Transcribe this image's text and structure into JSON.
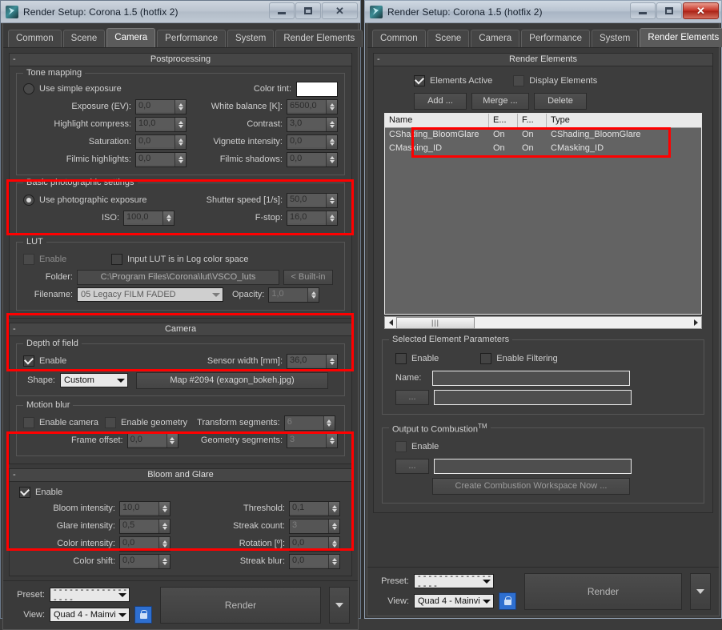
{
  "window_left": {
    "title": "Render Setup: Corona 1.5 (hotfix 2)",
    "tabs": [
      "Common",
      "Scene",
      "Camera",
      "Performance",
      "System",
      "Render Elements"
    ],
    "active_tab": "Camera",
    "rollout_postprocessing": {
      "title": "Postprocessing",
      "tone_mapping": {
        "label": "Tone mapping",
        "use_simple_exposure": "Use simple exposure",
        "use_simple_exposure_checked": false,
        "color_tint_label": "Color tint:",
        "color_tint_value": "#ffffff",
        "fields": [
          {
            "label": "Exposure (EV):",
            "value": "0,0"
          },
          {
            "label": "White balance [K]:",
            "value": "6500,0"
          },
          {
            "label": "Highlight compress:",
            "value": "10,0"
          },
          {
            "label": "Contrast:",
            "value": "3,0"
          },
          {
            "label": "Saturation:",
            "value": "0,0"
          },
          {
            "label": "Vignette intensity:",
            "value": "0,0"
          },
          {
            "label": "Filmic highlights:",
            "value": "0,0"
          },
          {
            "label": "Filmic shadows:",
            "value": "0,0"
          }
        ]
      },
      "basic_photographic": {
        "label": "Basic photographic settings",
        "use_photographic_exposure": "Use photographic exposure",
        "use_photographic_exposure_checked": true,
        "shutter_label": "Shutter speed [1/s]:",
        "shutter_value": "50,0",
        "iso_label": "ISO:",
        "iso_value": "100,0",
        "fstop_label": "F-stop:",
        "fstop_value": "16,0"
      },
      "lut": {
        "label": "LUT",
        "enable_label": "Enable",
        "enable_checked": false,
        "log_label": "Input LUT is in Log color space",
        "log_checked": false,
        "folder_label": "Folder:",
        "folder_value": "C:\\Program Files\\Corona\\lut\\VSCO_luts",
        "builtin_button": "< Built-in",
        "filename_label": "Filename:",
        "filename_value": "05 Legacy FILM FADED",
        "opacity_label": "Opacity:",
        "opacity_value": "1,0"
      }
    },
    "rollout_camera": {
      "title": "Camera",
      "depth_of_field": {
        "label": "Depth of field",
        "enable_label": "Enable",
        "enable_checked": true,
        "sensor_label": "Sensor width [mm]:",
        "sensor_value": "36,0",
        "shape_label": "Shape:",
        "shape_value": "Custom",
        "map_button": "Map #2094 (exagon_bokeh.jpg)"
      },
      "motion_blur": {
        "label": "Motion blur",
        "enable_camera_label": "Enable camera",
        "enable_camera_checked": false,
        "enable_geometry_label": "Enable geometry",
        "enable_geometry_checked": false,
        "transform_label": "Transform segments:",
        "transform_value": "6",
        "frame_offset_label": "Frame offset:",
        "frame_offset_value": "0,0",
        "geometry_label": "Geometry segments:",
        "geometry_value": "3"
      }
    },
    "rollout_bloom": {
      "title": "Bloom and Glare",
      "enable_label": "Enable",
      "enable_checked": true,
      "fields": [
        {
          "label": "Bloom intensity:",
          "value": "10,0"
        },
        {
          "label": "Threshold:",
          "value": "0,1"
        },
        {
          "label": "Glare intensity:",
          "value": "0,5"
        },
        {
          "label": "Streak count:",
          "value": "3"
        },
        {
          "label": "Color intensity:",
          "value": "0,0"
        },
        {
          "label": "Rotation  [º]:",
          "value": "0,0"
        },
        {
          "label": "Color shift:",
          "value": "0,0"
        },
        {
          "label": "Streak blur:",
          "value": "0,0"
        }
      ]
    },
    "bottom": {
      "preset_label": "Preset:",
      "preset_value": "- - - - - - - - - - - - - - - - - -",
      "view_label": "View:",
      "view_value": "Quad 4 - Mainvi",
      "render_button": "Render",
      "lock_icon": "lock-icon"
    }
  },
  "window_right": {
    "title": "Render Setup: Corona 1.5 (hotfix 2)",
    "tabs": [
      "Common",
      "Scene",
      "Camera",
      "Performance",
      "System",
      "Render Elements"
    ],
    "active_tab": "Render Elements",
    "rollout": {
      "title": "Render Elements",
      "elements_active_label": "Elements Active",
      "elements_active_checked": true,
      "display_elements_label": "Display Elements",
      "display_elements_checked": false,
      "buttons": [
        "Add ...",
        "Merge ...",
        "Delete"
      ],
      "table": {
        "columns": [
          "Name",
          "E...",
          "F...",
          "Type"
        ],
        "rows": [
          [
            "CShading_BloomGlare",
            "On",
            "On",
            "CShading_BloomGlare"
          ],
          [
            "CMasking_ID",
            "On",
            "On",
            "CMasking_ID"
          ]
        ]
      },
      "selected_element_parameters": {
        "label": "Selected Element Parameters",
        "enable_label": "Enable",
        "enable_checked": false,
        "enable_filtering_label": "Enable Filtering",
        "enable_filtering_checked": false,
        "name_label": "Name:",
        "name_value": "",
        "browse_button": "...",
        "path_value": ""
      },
      "output_combustion": {
        "label": "Output to Combustion",
        "label_sup": "TM",
        "enable_label": "Enable",
        "enable_checked": false,
        "browse_button": "...",
        "path_value": "",
        "create_button": "Create Combustion Workspace Now ..."
      }
    },
    "bottom": {
      "preset_label": "Preset:",
      "preset_value": "- - - - - - - - - - - - - - - - - -",
      "view_label": "View:",
      "view_value": "Quad 4 - Mainvi",
      "render_button": "Render",
      "lock_icon": "lock-icon"
    }
  },
  "annotations": {
    "highlight_color": "#ff0000",
    "boxes": [
      {
        "name": "basic-photographic-settings-highlight"
      },
      {
        "name": "depth-of-field-highlight"
      },
      {
        "name": "bloom-and-glare-highlight"
      },
      {
        "name": "render-elements-list-highlight"
      }
    ]
  }
}
